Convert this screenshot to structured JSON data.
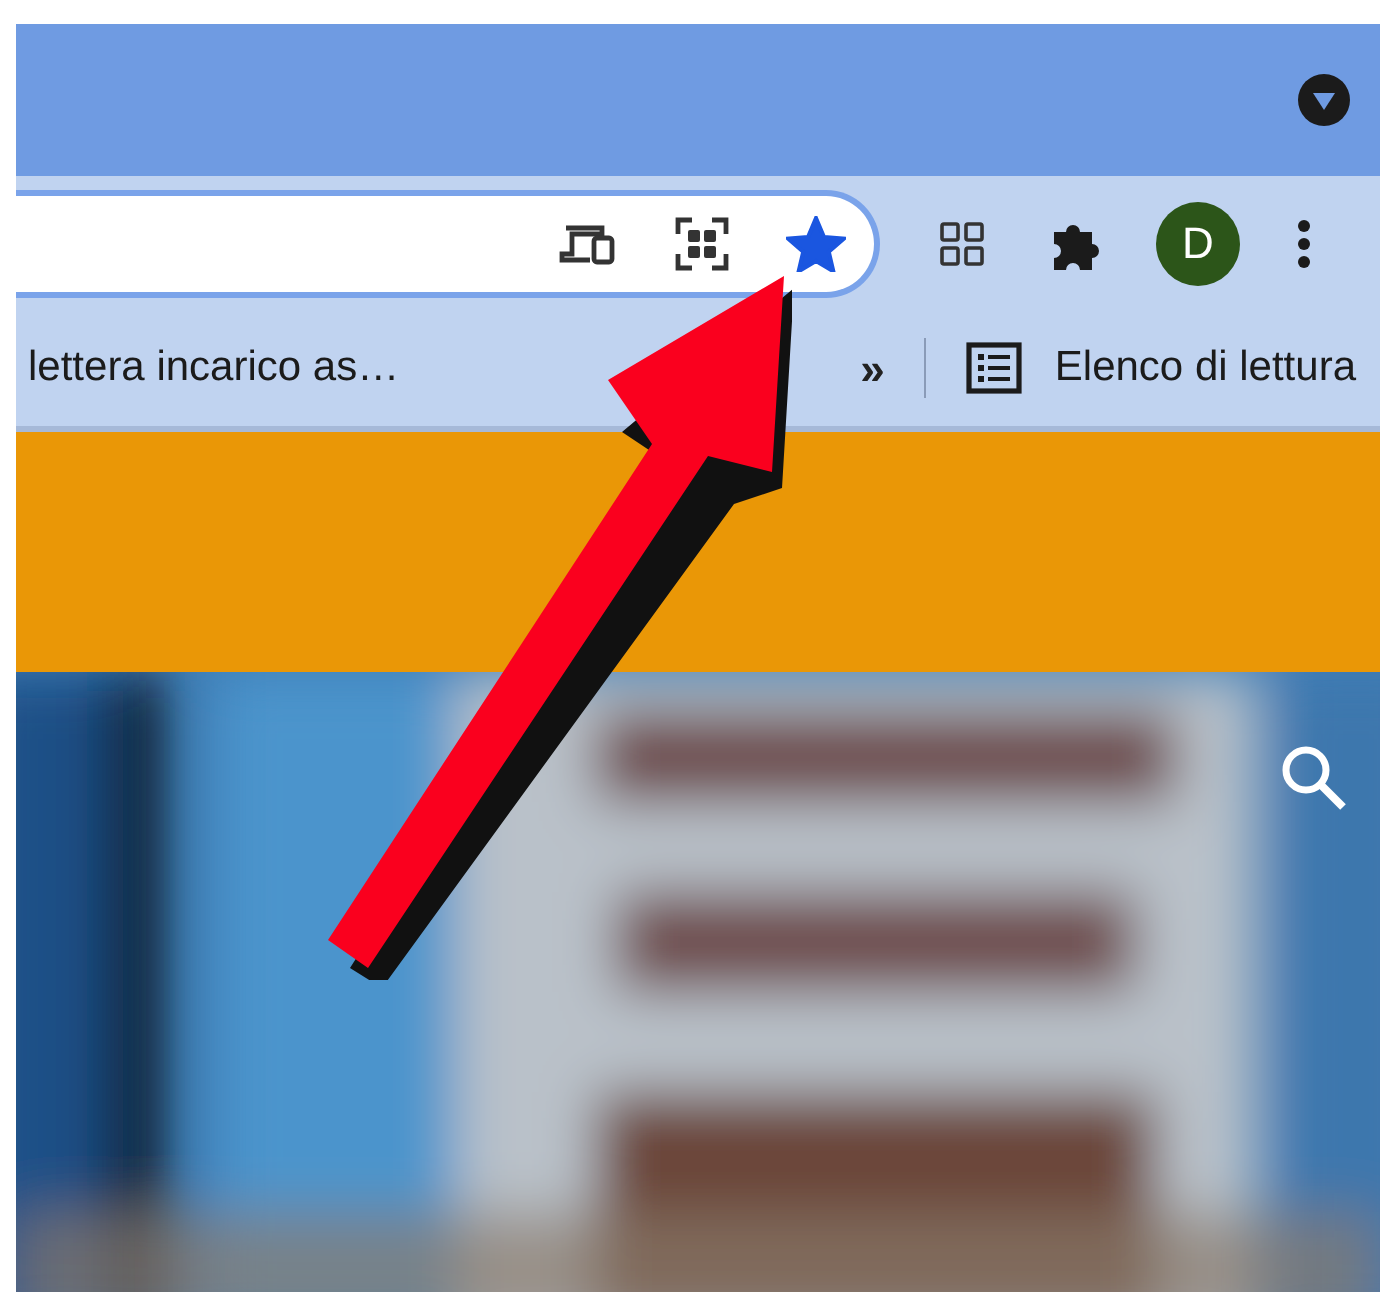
{
  "toolbar": {
    "avatar": "D",
    "bookmarked": true
  },
  "bookmarks_bar": {
    "items": [
      {
        "label": "lettera incarico as…"
      }
    ],
    "overflow": "»",
    "reading_list": "Elenco di lettura"
  }
}
